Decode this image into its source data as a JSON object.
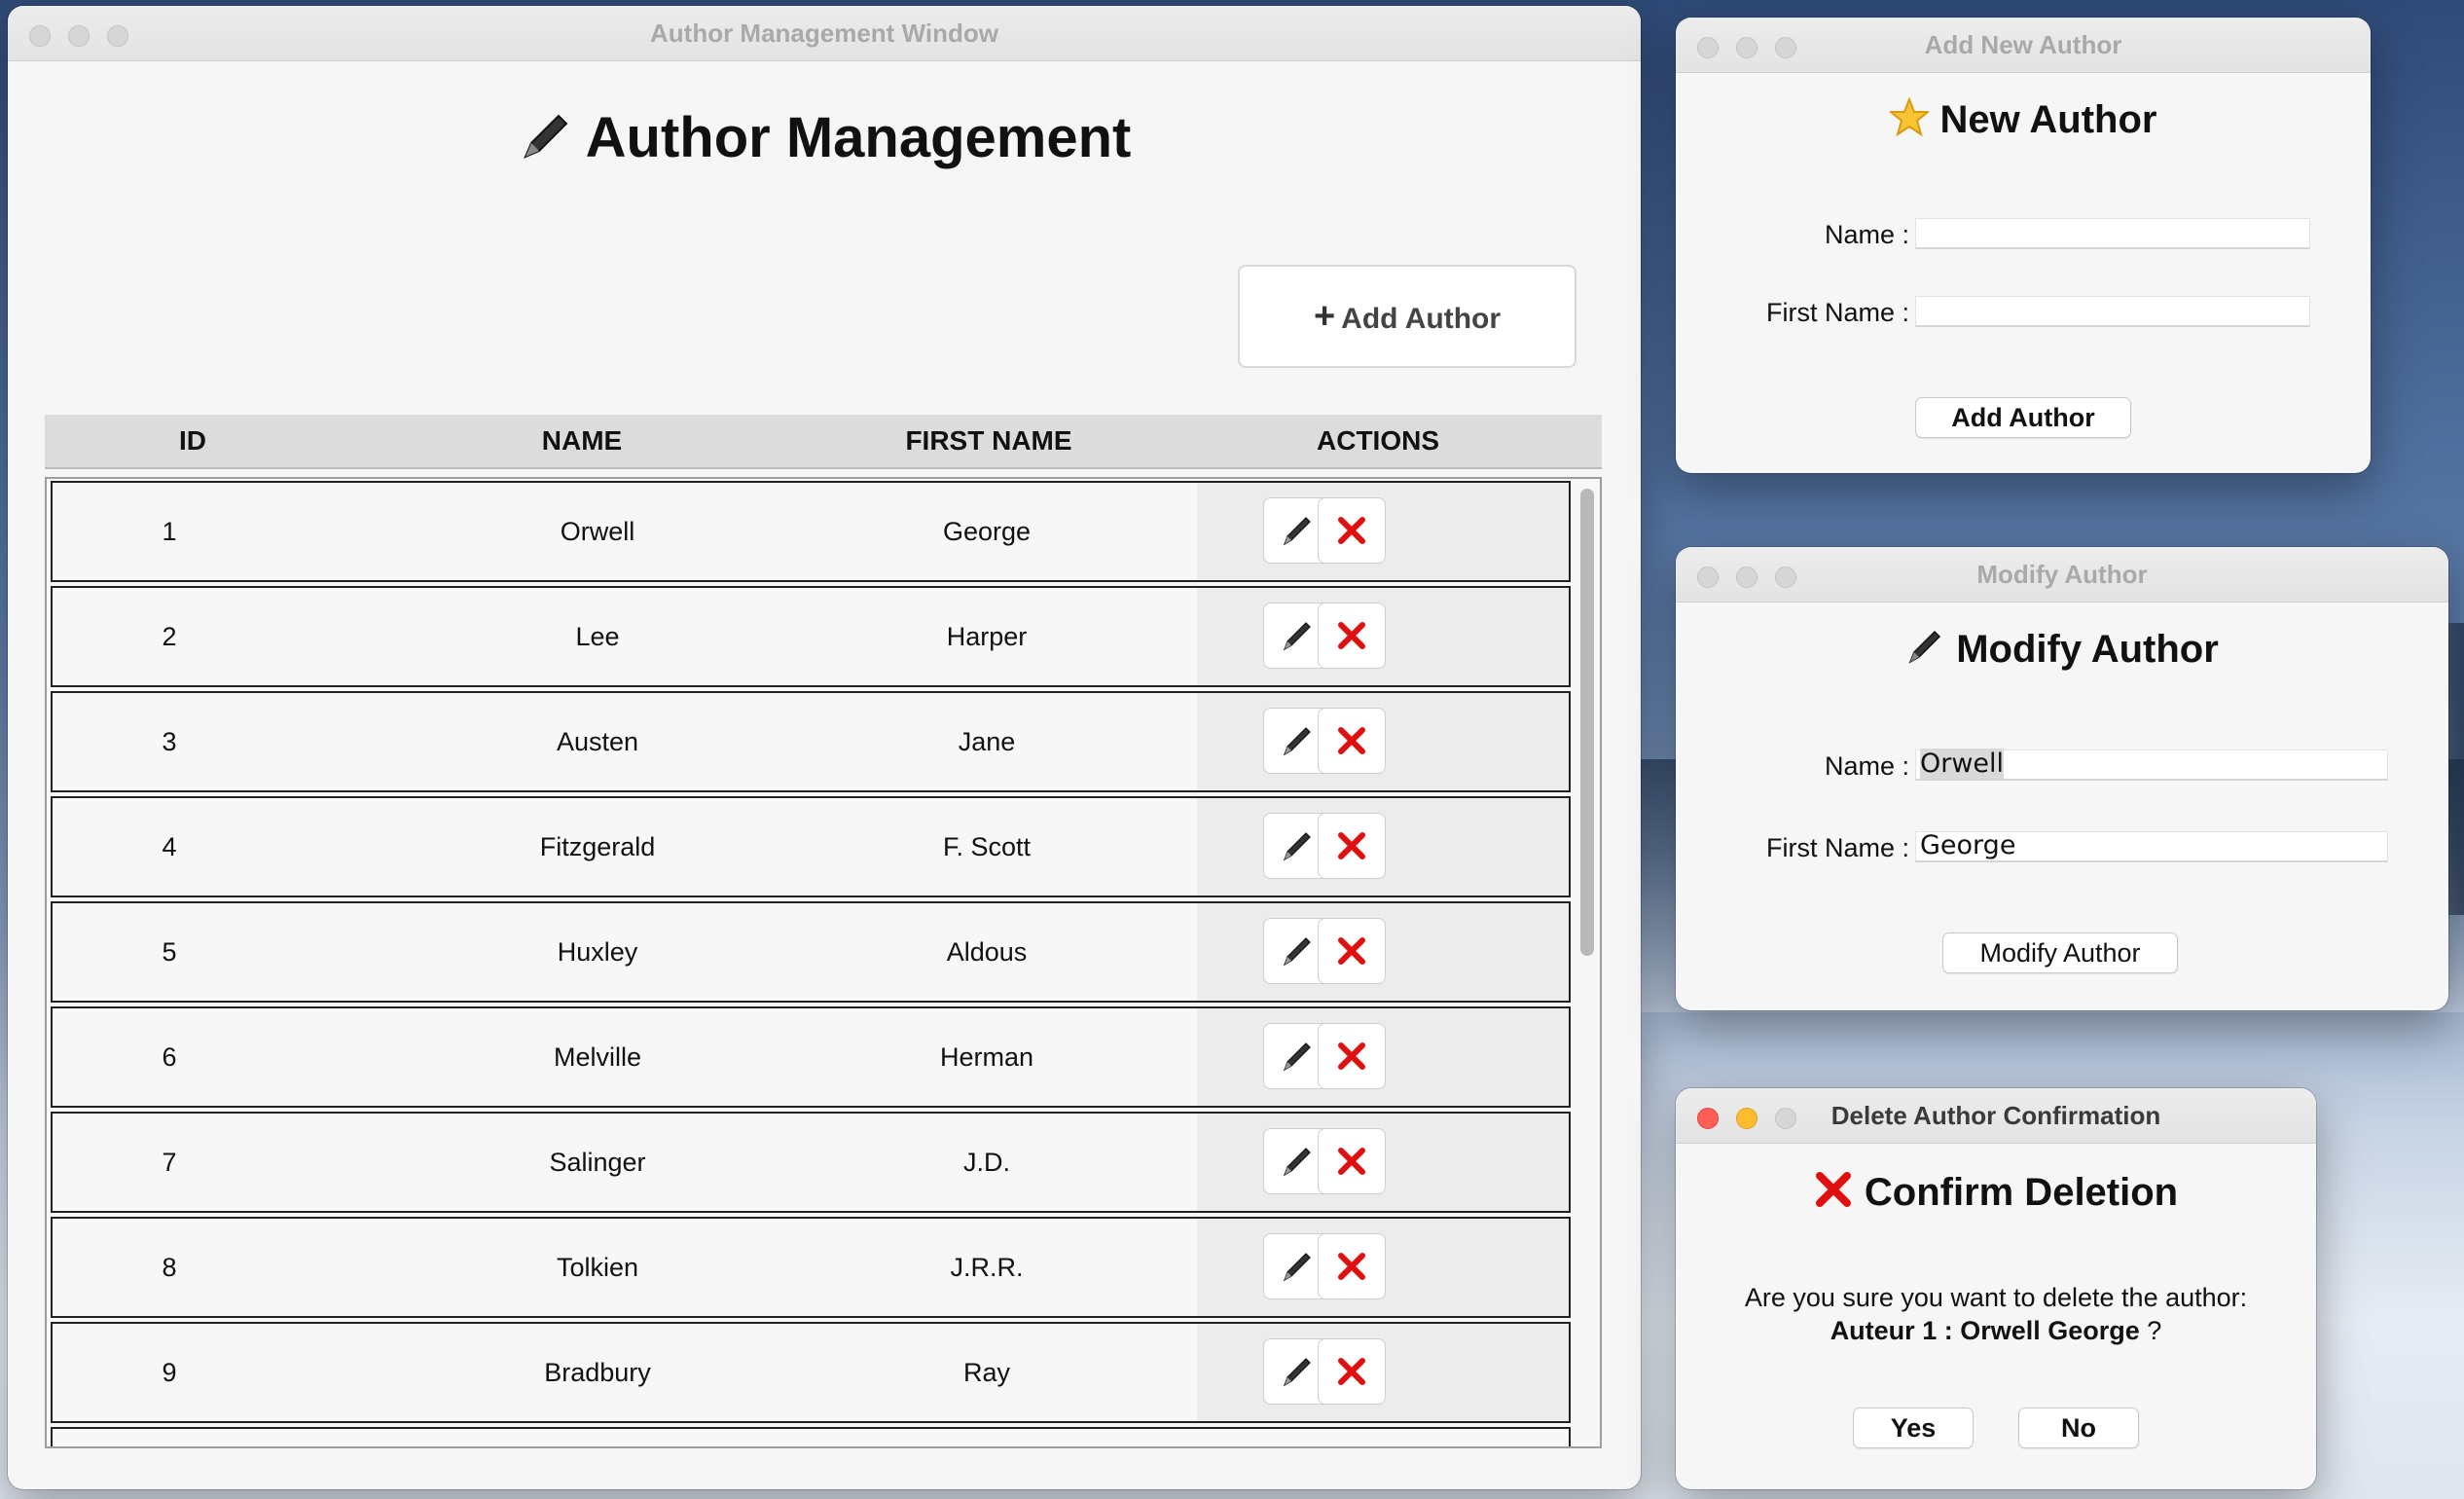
{
  "main_window": {
    "title": "Author Management Window",
    "heading": "Author Management",
    "add_button": "Add Author",
    "add_button_icon": "plus-icon",
    "columns": [
      "ID",
      "NAME",
      "FIRST NAME",
      "ACTIONS"
    ],
    "rows": [
      {
        "id": "1",
        "name": "Orwell",
        "first_name": "George"
      },
      {
        "id": "2",
        "name": "Lee",
        "first_name": "Harper"
      },
      {
        "id": "3",
        "name": "Austen",
        "first_name": "Jane"
      },
      {
        "id": "4",
        "name": "Fitzgerald",
        "first_name": "F. Scott"
      },
      {
        "id": "5",
        "name": "Huxley",
        "first_name": "Aldous"
      },
      {
        "id": "6",
        "name": "Melville",
        "first_name": "Herman"
      },
      {
        "id": "7",
        "name": "Salinger",
        "first_name": "J.D."
      },
      {
        "id": "8",
        "name": "Tolkien",
        "first_name": "J.R.R."
      },
      {
        "id": "9",
        "name": "Bradbury",
        "first_name": "Ray"
      }
    ],
    "row_actions": {
      "edit_icon": "pen-icon",
      "delete_icon": "red-x-icon"
    }
  },
  "add_window": {
    "title": "Add New Author",
    "heading": "New Author",
    "heading_icon": "star-icon",
    "name_label": "Name :",
    "first_name_label": "First Name :",
    "name_value": "",
    "first_name_value": "",
    "submit": "Add Author"
  },
  "modify_window": {
    "title": "Modify Author",
    "heading": "Modify Author",
    "heading_icon": "pen-icon",
    "name_label": "Name :",
    "first_name_label": "First Name :",
    "name_value": "Orwell",
    "first_name_value": "George",
    "submit": "Modify Author"
  },
  "delete_window": {
    "title": "Delete Author Confirmation",
    "heading": "Confirm Deletion",
    "heading_icon": "red-x-icon",
    "message": "Are you sure you want to delete the author:",
    "author_ref": "Auteur 1 : Orwell George",
    "question_mark": "?",
    "yes": "Yes",
    "no": "No"
  },
  "colors": {
    "delete_red": "#e01010",
    "active_close": "#ff5f57",
    "active_minimize": "#febc2e"
  }
}
